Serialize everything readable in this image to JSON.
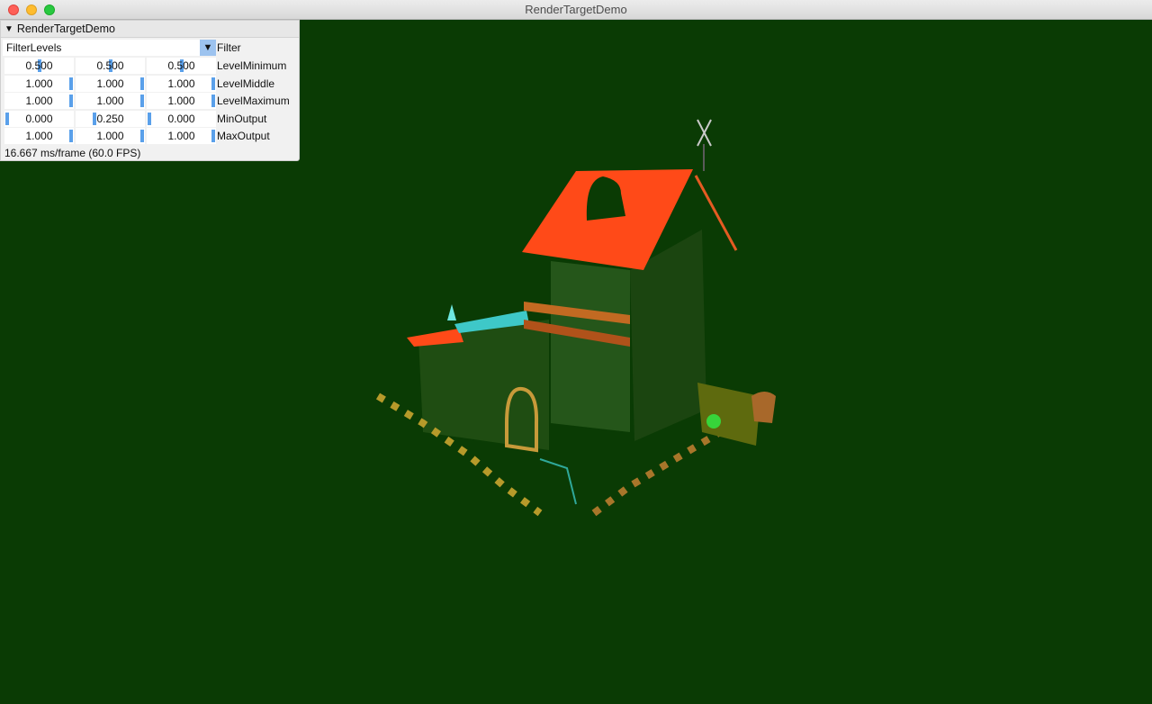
{
  "window": {
    "title": "RenderTargetDemo"
  },
  "panel": {
    "title": "RenderTargetDemo",
    "combo": {
      "value": "FilterLevels",
      "label": "Filter"
    },
    "rows": [
      {
        "label": "LevelMinimum",
        "values": [
          "0.500",
          "0.500",
          "0.500"
        ],
        "fractions": [
          0.5,
          0.5,
          0.5
        ]
      },
      {
        "label": "LevelMiddle",
        "values": [
          "1.000",
          "1.000",
          "1.000"
        ],
        "fractions": [
          1.0,
          1.0,
          1.0
        ]
      },
      {
        "label": "LevelMaximum",
        "values": [
          "1.000",
          "1.000",
          "1.000"
        ],
        "fractions": [
          1.0,
          1.0,
          1.0
        ]
      },
      {
        "label": "MinOutput",
        "values": [
          "0.000",
          "0.250",
          "0.000"
        ],
        "fractions": [
          0.0,
          0.25,
          0.0
        ]
      },
      {
        "label": "MaxOutput",
        "values": [
          "1.000",
          "1.000",
          "1.000"
        ],
        "fractions": [
          1.0,
          1.0,
          1.0
        ]
      }
    ],
    "fps": "16.667 ms/frame (60.0 FPS)"
  },
  "colors": {
    "background": "#0a3b04",
    "roof": "#ff4a18",
    "accent": "#5aa0ea"
  }
}
